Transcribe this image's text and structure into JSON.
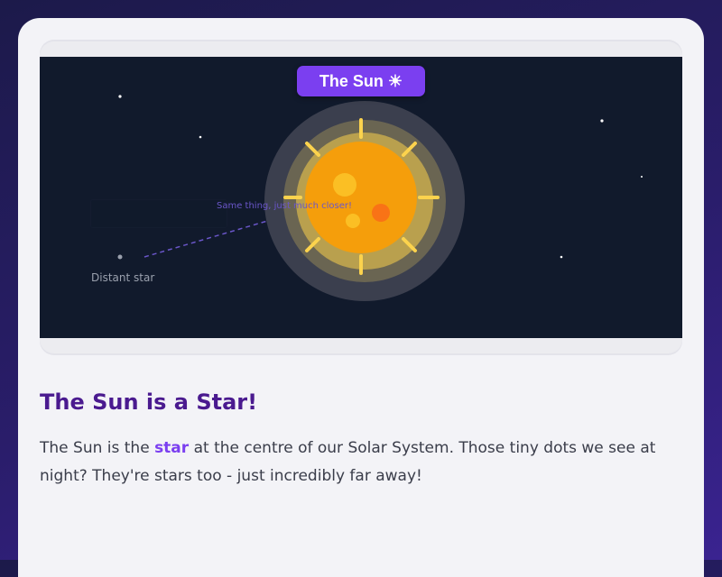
{
  "scene": {
    "sun_label": "The Sun ☀",
    "distant_star_label": "Distant star",
    "comparison_text": "Same thing, just much closer!",
    "colors": {
      "space": "#111a2c",
      "sun_core": "#f59e0b",
      "sun_rays": "#fcd34d",
      "accent": "#7b3ff0"
    }
  },
  "content": {
    "heading": "The Sun is a Star!",
    "paragraph_before": "The Sun is the ",
    "highlight_word": "star",
    "paragraph_after": " at the centre of our Solar System. Those tiny dots we see at night? They're stars too - just incredibly far away!"
  }
}
